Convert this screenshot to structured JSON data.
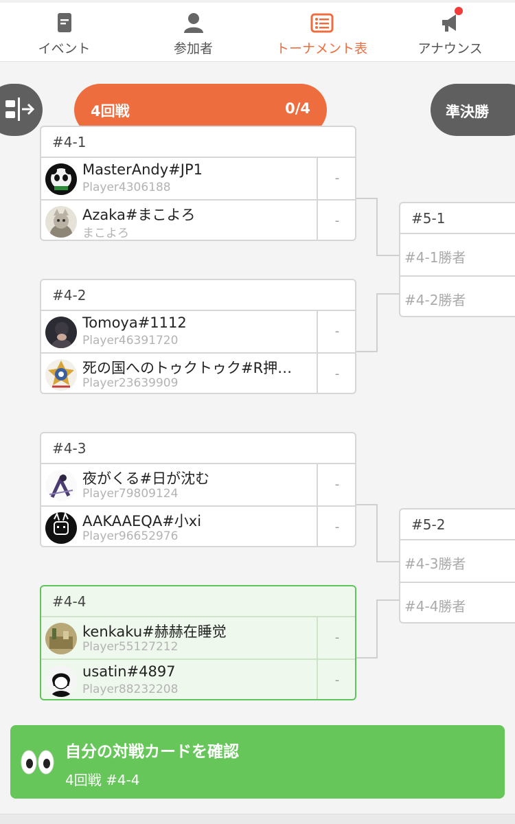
{
  "nav": {
    "items": [
      {
        "label": "イベント",
        "icon": "document-icon"
      },
      {
        "label": "参加者",
        "icon": "person-icon"
      },
      {
        "label": "トーナメント表",
        "icon": "bracket-list-icon",
        "active": true
      },
      {
        "label": "アナウンス",
        "icon": "megaphone-icon",
        "badge": true
      }
    ],
    "active_color": "#ee6d3f"
  },
  "round": {
    "name": "4回戦",
    "progress": "0/4",
    "next_round": "準決勝"
  },
  "matches": [
    {
      "id": "#4-1",
      "players": [
        {
          "name": "MasterAndy#JP1",
          "sub": "Player4306188",
          "score": "-"
        },
        {
          "name": "Azaka#まこよろ",
          "sub": "まこよろ",
          "score": "-"
        }
      ]
    },
    {
      "id": "#4-2",
      "players": [
        {
          "name": "Tomoya#1112",
          "sub": "Player46391720",
          "score": "-"
        },
        {
          "name": "死の国へのトゥクトゥク#R押…",
          "sub": "Player23639909",
          "score": "-"
        }
      ]
    },
    {
      "id": "#4-3",
      "players": [
        {
          "name": "夜がくる#日が沈む",
          "sub": "Player79809124",
          "score": "-"
        },
        {
          "name": "AAKAAEQA#小xi",
          "sub": "Player96652976",
          "score": "-"
        }
      ]
    },
    {
      "id": "#4-4",
      "highlight": true,
      "players": [
        {
          "name": "kenkaku#赫赫在睡觉",
          "sub": "Player55127212",
          "score": "-"
        },
        {
          "name": "usatin#4897",
          "sub": "Player88232208",
          "score": "-"
        }
      ]
    }
  ],
  "next_matches": [
    {
      "id": "#5-1",
      "slots": [
        "#4-1勝者",
        "#4-2勝者"
      ]
    },
    {
      "id": "#5-2",
      "slots": [
        "#4-3勝者",
        "#4-4勝者"
      ]
    }
  ],
  "my_card": {
    "title": "自分の対戦カードを確認",
    "subtitle": "4回戦 #4-4",
    "color": "#66c65a"
  }
}
